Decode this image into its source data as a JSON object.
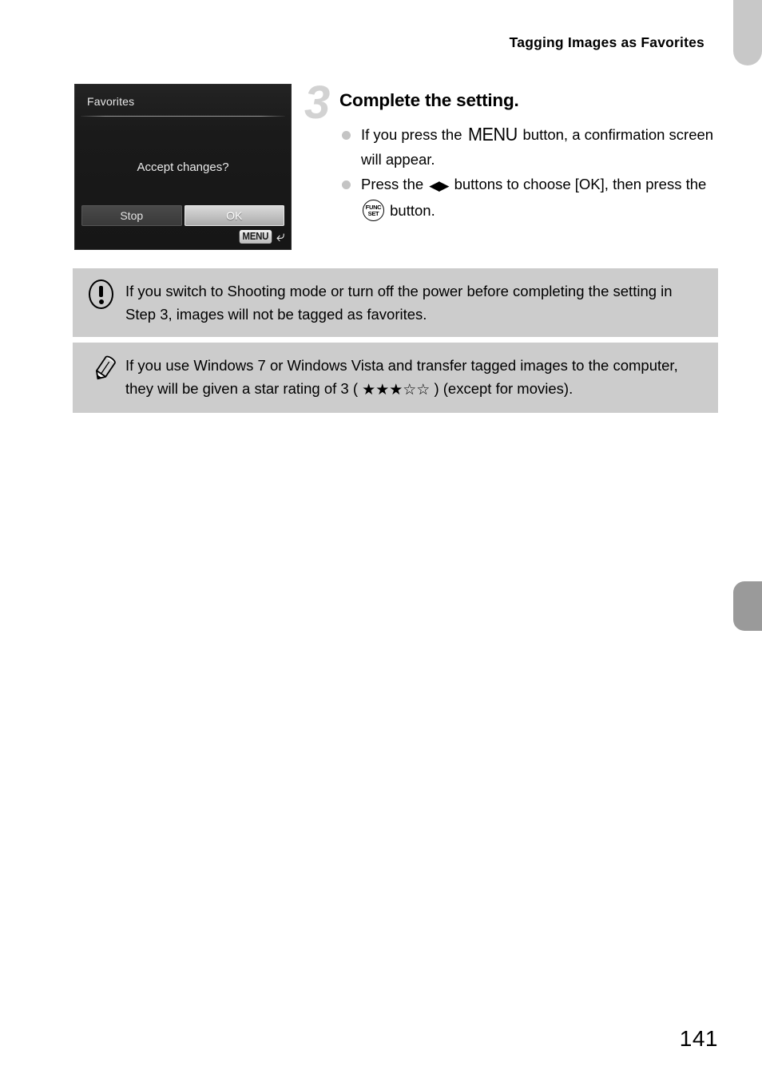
{
  "header": {
    "title": "Tagging Images as Favorites"
  },
  "camera_screen": {
    "title": "Favorites",
    "prompt": "Accept changes?",
    "buttons": [
      {
        "label": "Stop",
        "state": "normal"
      },
      {
        "label": "OK",
        "state": "selected"
      }
    ],
    "footer_badge": "MENU",
    "footer_icon": "return-arrow-icon"
  },
  "step": {
    "number": "3",
    "title": "Complete the setting.",
    "bullets": [
      {
        "text_before": "If you press the ",
        "glyph": "MENU",
        "text_after": " button, a confirmation screen will appear."
      },
      {
        "text_before": "Press the ",
        "glyph_arrows": "◀▶",
        "text_middle": " buttons to choose [OK], then press the ",
        "glyph_func_top": "FUNC",
        "glyph_func_bottom": "SET",
        "text_after": " button."
      }
    ]
  },
  "notes": [
    {
      "icon": "warning-icon",
      "text": "If you switch to Shooting mode or turn off the power before completing the setting in Step 3, images will not be tagged as favorites."
    },
    {
      "icon": "pencil-icon",
      "text_before": "If you use Windows 7 or Windows Vista and transfer tagged images to the computer, they will be given a star rating of 3 ( ",
      "stars": "★★★☆☆",
      "text_after": " ) (except for movies)."
    }
  ],
  "page_number": "141",
  "colors": {
    "note_background": "#cccccc",
    "step_number": "#d2d2d2",
    "tab_top": "#c8c8c8",
    "tab_side": "#9a9a9a",
    "lcd_background": "#1c1c1c"
  }
}
